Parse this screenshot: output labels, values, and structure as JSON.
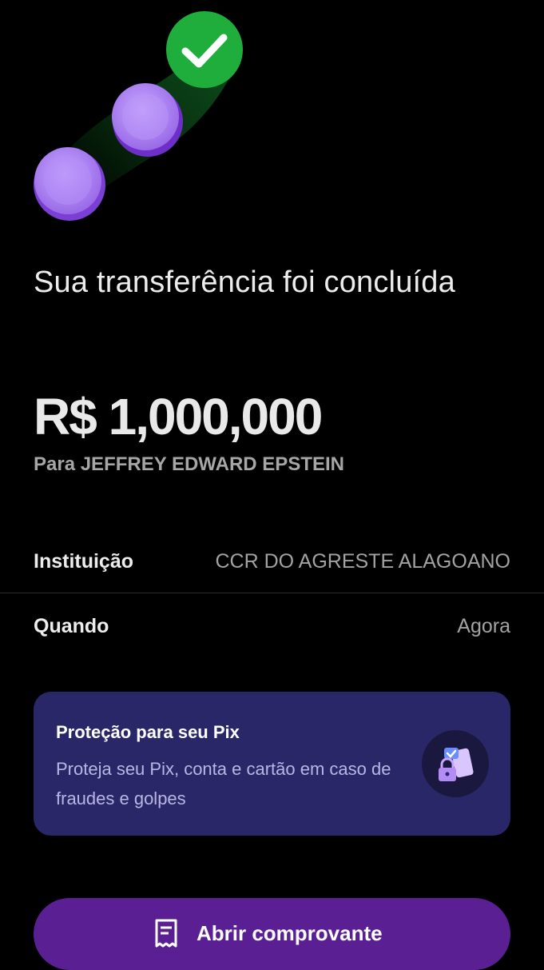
{
  "header": {
    "illustration_icon": "coins-transfer-success-icon",
    "title": "Sua transferência foi concluída"
  },
  "transfer": {
    "amount": "R$ 1,000,000",
    "recipient": "Para JEFFREY EDWARD EPSTEIN"
  },
  "details": {
    "institution_label": "Instituição",
    "institution_value": "CCR DO AGRESTE ALAGOANO",
    "when_label": "Quando",
    "when_value": "Agora"
  },
  "protection_card": {
    "title": "Proteção para seu Pix",
    "description": "Proteja seu Pix, conta e cartão em caso de fraudes e golpes",
    "icon": "shield-lock-icon"
  },
  "actions": {
    "open_receipt_label": "Abrir comprovante",
    "open_receipt_icon": "receipt-icon"
  },
  "colors": {
    "background": "#000000",
    "accent_green": "#1fae3c",
    "coin_purple": "#a77af0",
    "card_background": "#2a2769",
    "button_purple": "#5a1f93"
  }
}
